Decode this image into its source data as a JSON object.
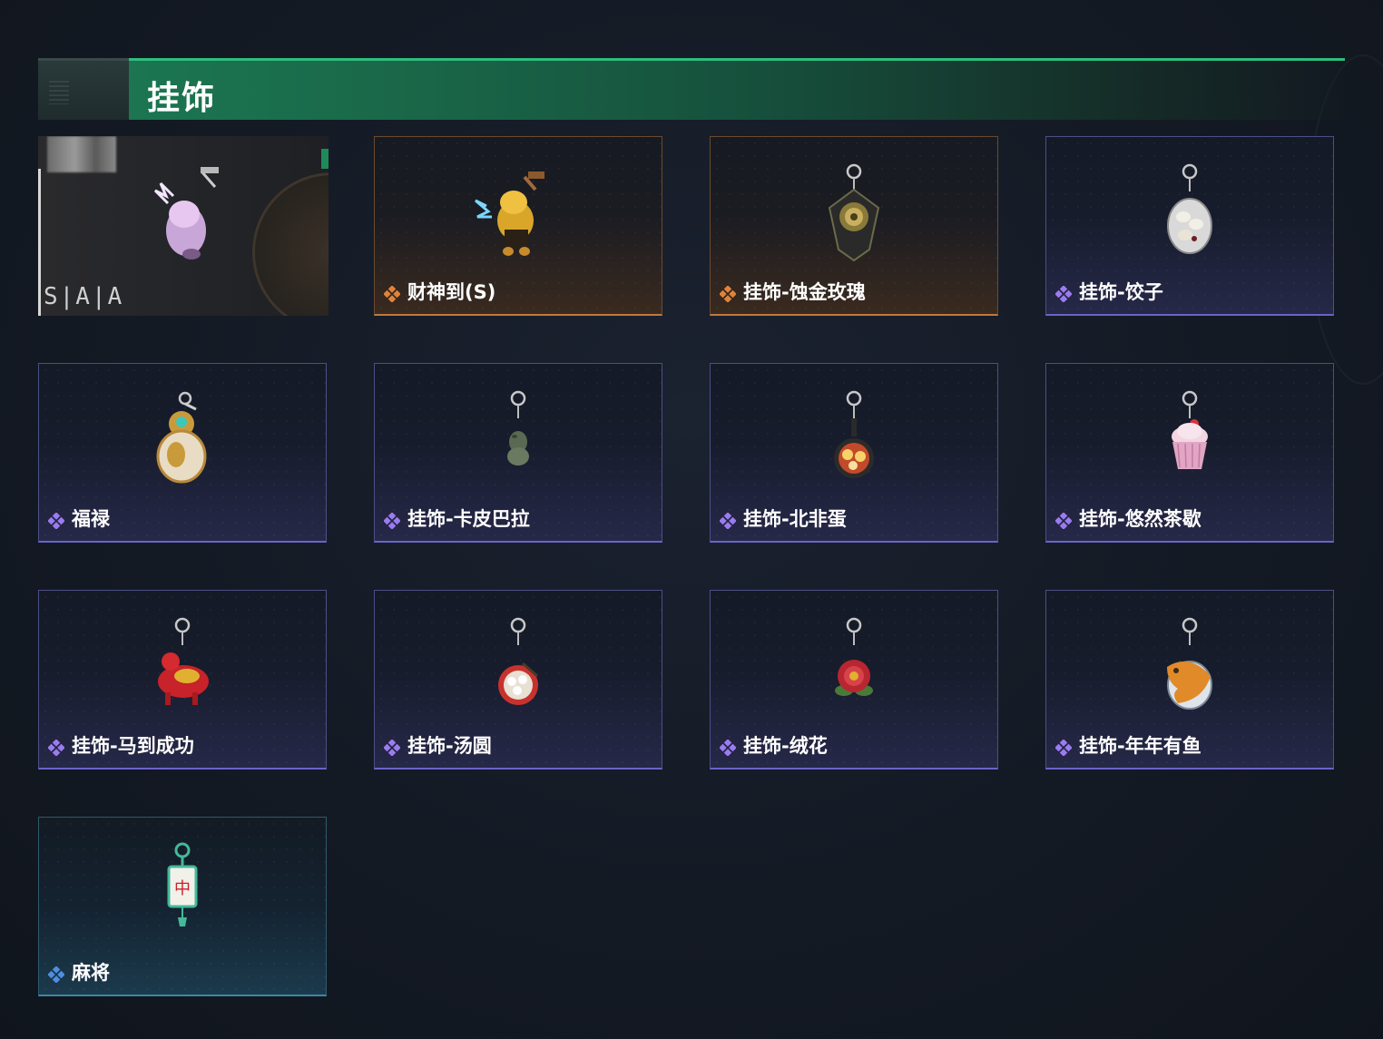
{
  "section": {
    "title": "挂饰"
  },
  "featured": {
    "badge_text": "S|A|A"
  },
  "items": [
    {
      "label": "财神到(S)",
      "rarity": "orange",
      "icon": "caishen-figure-icon"
    },
    {
      "label": "挂饰-蚀金玫瑰",
      "rarity": "orange",
      "icon": "gold-rose-charm-icon"
    },
    {
      "label": "挂饰-饺子",
      "rarity": "purple",
      "icon": "dumpling-plate-charm-icon"
    },
    {
      "label": "福禄",
      "rarity": "purple",
      "icon": "gourd-charm-icon"
    },
    {
      "label": "挂饰-卡皮巴拉",
      "rarity": "purple",
      "icon": "capybara-charm-icon"
    },
    {
      "label": "挂饰-北非蛋",
      "rarity": "purple",
      "icon": "shakshuka-pan-charm-icon"
    },
    {
      "label": "挂饰-悠然茶歇",
      "rarity": "purple",
      "icon": "cupcake-charm-icon"
    },
    {
      "label": "挂饰-马到成功",
      "rarity": "purple",
      "icon": "red-horse-charm-icon"
    },
    {
      "label": "挂饰-汤圆",
      "rarity": "purple",
      "icon": "tangyuan-bowl-charm-icon"
    },
    {
      "label": "挂饰-绒花",
      "rarity": "purple",
      "icon": "velvet-flower-charm-icon"
    },
    {
      "label": "挂饰-年年有鱼",
      "rarity": "purple",
      "icon": "fish-plate-charm-icon"
    },
    {
      "label": "麻将",
      "rarity": "teal",
      "icon": "mahjong-tile-charm-icon"
    }
  ],
  "colors": {
    "header_green": "#1c7a53",
    "rarity_orange": "#c07a3e",
    "rarity_purple": "#6a64c8",
    "rarity_teal": "#3b86a8",
    "gem_orange": "#e0833a",
    "gem_purple": "#9a7cf0",
    "gem_teal": "#4f8de0"
  }
}
